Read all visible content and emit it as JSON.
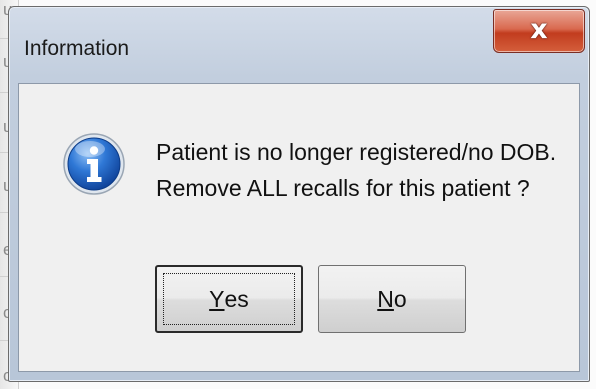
{
  "background": {
    "fragment_letters": [
      "u",
      "u",
      "u",
      "u",
      "e",
      "c",
      "c"
    ]
  },
  "dialog": {
    "title": "Information",
    "close_glyph": "x",
    "icon": "information-icon",
    "message_lines": [
      "Patient is no longer registered/no DOB.",
      "Remove ALL recalls for this patient ?"
    ],
    "buttons": {
      "yes": {
        "accel": "Y",
        "rest": "es"
      },
      "no": {
        "accel": "N",
        "rest": "o"
      }
    }
  },
  "colors": {
    "close_button": "#c8442a",
    "info_icon": "#1f5fbf",
    "frame": "#c2cede"
  }
}
